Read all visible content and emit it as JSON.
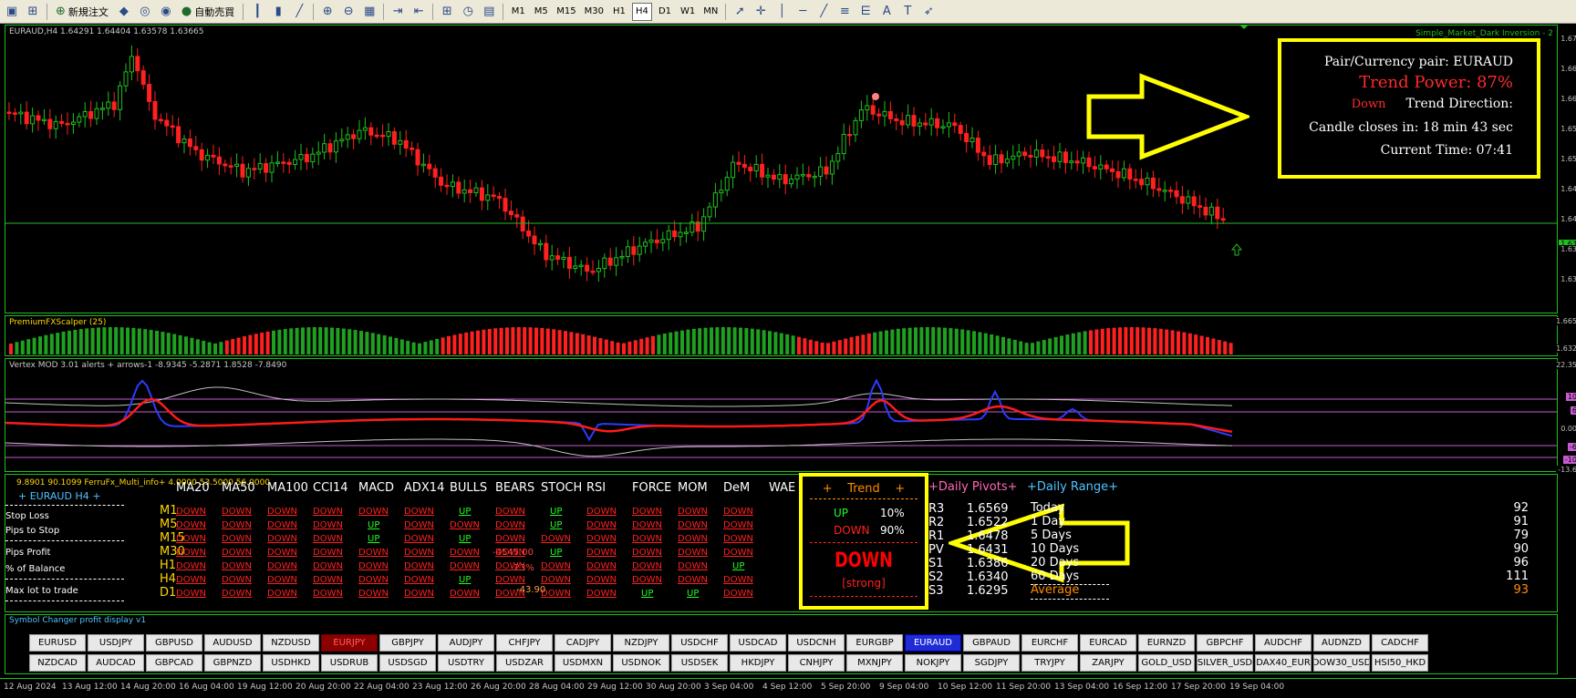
{
  "toolbar": {
    "new_order": "新規注文",
    "autotrade": "自動売買",
    "timeframes": [
      "M1",
      "M5",
      "M15",
      "M30",
      "H1",
      "H4",
      "D1",
      "W1",
      "MN"
    ],
    "active_timeframe": "H4"
  },
  "main_chart": {
    "label": "EURAUD,H4  1.64291 1.64404 1.63578 1.63665",
    "top_right_label": "Simple_Market_Dark Inversion - 2",
    "current_price_tag": "1.63",
    "y_labels": [
      "1.67",
      "1.66",
      "1.66",
      "1.65",
      "1.65",
      "1.64",
      "1.64",
      "1.63",
      "1.63"
    ],
    "colors": {
      "bull": "#20c020",
      "bear": "#ff2020",
      "grid": "#1fbf1f"
    }
  },
  "info_box": {
    "pair": "Pair/Currency pair: EURAUD",
    "trend_power": "Trend Power: 87%",
    "direction_value": "Down",
    "direction_label": "Trend Direction:",
    "candle_close": "Candle closes in: 18 min 43 sec",
    "current_time": "Current Time: 07:41"
  },
  "scalper_pane": {
    "label": "PremiumFXScalper (25)",
    "y_top": "1.665",
    "y_bottom": "1.632"
  },
  "vertex_pane": {
    "label": "Vertex MOD 3.01 alerts + arrows-1 -8.9345 -5.2871 1.8528 -7.8490",
    "y_labels": [
      "22.35",
      "10",
      "6",
      "0.00",
      "-6",
      "-10",
      "-13.6"
    ]
  },
  "multi_info": {
    "label": "9.8901 90.1099  FerruFx_Multi_info+ 4.0000 53.5000 56.0000",
    "symbol_title": "+ EURAUD  H4 +",
    "side_labels": [
      "Stop Loss",
      "Pips to Stop",
      "Pips Profit",
      "% of Balance",
      "Max lot to trade"
    ],
    "headers": [
      "MA20",
      "MA50",
      "MA100",
      "CCI14",
      "MACD",
      "ADX14",
      "BULLS",
      "BEARS",
      "STOCH",
      "RSI",
      "FORCE",
      "MOM",
      "DeM",
      "WAE"
    ],
    "timeframes": [
      "M1",
      "M5",
      "M15",
      "M30",
      "H1",
      "H4",
      "D1"
    ],
    "rows": [
      [
        "DOWN",
        "DOWN",
        "DOWN",
        "DOWN",
        "DOWN",
        "DOWN",
        "UP",
        "DOWN",
        "UP",
        "DOWN",
        "DOWN",
        "DOWN",
        "DOWN"
      ],
      [
        "DOWN",
        "DOWN",
        "DOWN",
        "DOWN",
        "UP",
        "DOWN",
        "DOWN",
        "DOWN",
        "UP",
        "DOWN",
        "DOWN",
        "DOWN",
        "DOWN"
      ],
      [
        "DOWN",
        "DOWN",
        "DOWN",
        "DOWN",
        "UP",
        "DOWN",
        "UP",
        "DOWN",
        "DOWN",
        "DOWN",
        "DOWN",
        "DOWN",
        "DOWN"
      ],
      [
        "DOWN",
        "DOWN",
        "DOWN",
        "DOWN",
        "DOWN",
        "DOWN",
        "DOWN",
        "DOWN",
        "UP",
        "DOWN",
        "DOWN",
        "DOWN",
        "DOWN"
      ],
      [
        "DOWN",
        "DOWN",
        "DOWN",
        "DOWN",
        "DOWN",
        "DOWN",
        "DOWN",
        "DOWN",
        "DOWN",
        "DOWN",
        "DOWN",
        "DOWN",
        "UP"
      ],
      [
        "DOWN",
        "DOWN",
        "DOWN",
        "DOWN",
        "DOWN",
        "DOWN",
        "UP",
        "DOWN",
        "DOWN",
        "DOWN",
        "DOWN",
        "DOWN",
        "DOWN"
      ],
      [
        "DOWN",
        "DOWN",
        "DOWN",
        "DOWN",
        "DOWN",
        "DOWN",
        "DOWN",
        "DOWN",
        "DOWN",
        "DOWN",
        "UP",
        "UP",
        "DOWN"
      ]
    ],
    "overlay_values": [
      "-4545.00",
      "-23%",
      "-43.90"
    ]
  },
  "trend_box": {
    "title": "+    Trend    +",
    "up_label": "UP",
    "up_value": "10%",
    "down_label": "DOWN",
    "down_value": "90%",
    "signal": "DOWN",
    "strength": "[strong]"
  },
  "pivots": {
    "title": "+Daily Pivots+",
    "rows": [
      {
        "name": "R3",
        "value": "1.6569"
      },
      {
        "name": "R2",
        "value": "1.6522"
      },
      {
        "name": "R1",
        "value": "1.6478"
      },
      {
        "name": "PV",
        "value": "1.6431"
      },
      {
        "name": "S1",
        "value": "1.6386"
      },
      {
        "name": "S2",
        "value": "1.6340"
      },
      {
        "name": "S3",
        "value": "1.6295"
      }
    ]
  },
  "daily_range": {
    "title": "+Daily Range+",
    "rows": [
      {
        "name": "Today",
        "value": "92"
      },
      {
        "name": "1 Day",
        "value": "91"
      },
      {
        "name": "5 Days",
        "value": "79"
      },
      {
        "name": "10 Days",
        "value": "90"
      },
      {
        "name": "20 Days",
        "value": "96"
      },
      {
        "name": "60 Days",
        "value": "111"
      },
      {
        "name": "Average",
        "value": "93"
      }
    ]
  },
  "symbol_changer": {
    "label": "Symbol Changer profit display v1",
    "row1": [
      "EURUSD",
      "USDJPY",
      "GBPUSD",
      "AUDUSD",
      "NZDUSD",
      "EURJPY",
      "GBPJPY",
      "AUDJPY",
      "CHFJPY",
      "CADJPY",
      "NZDJPY",
      "USDCHF",
      "USDCAD",
      "USDCNH",
      "EURGBP",
      "EURAUD",
      "GBPAUD",
      "EURCHF",
      "EURCAD",
      "EURNZD",
      "GBPCHF",
      "AUDCHF",
      "AUDNZD",
      "CADCHF"
    ],
    "row2": [
      "NZDCAD",
      "AUDCAD",
      "GBPCAD",
      "GBPNZD",
      "USDHKD",
      "USDRUB",
      "USDSGD",
      "USDTRY",
      "USDZAR",
      "USDMXN",
      "USDNOK",
      "USDSEK",
      "HKDJPY",
      "CNHJPY",
      "MXNJPY",
      "NOKJPY",
      "SGDJPY",
      "TRYJPY",
      "ZARJPY",
      "GOLD_USD",
      "SILVER_USD",
      "DAX40_EUR",
      "DOW30_USD",
      "HSI50_HKD"
    ],
    "selected_red": "EURJPY",
    "selected_blue": "EURAUD"
  },
  "x_axis": [
    "12 Aug 2024",
    "13 Aug 12:00",
    "14 Aug 20:00",
    "16 Aug 04:00",
    "19 Aug 12:00",
    "20 Aug 20:00",
    "22 Aug 04:00",
    "23 Aug 12:00",
    "26 Aug 20:00",
    "28 Aug 04:00",
    "29 Aug 12:00",
    "30 Aug 20:00",
    "3 Sep 04:00",
    "4 Sep 12:00",
    "5 Sep 20:00",
    "9 Sep 04:00",
    "10 Sep 12:00",
    "11 Sep 20:00",
    "13 Sep 04:00",
    "16 Sep 12:00",
    "17 Sep 20:00",
    "19 Sep 04:00"
  ]
}
